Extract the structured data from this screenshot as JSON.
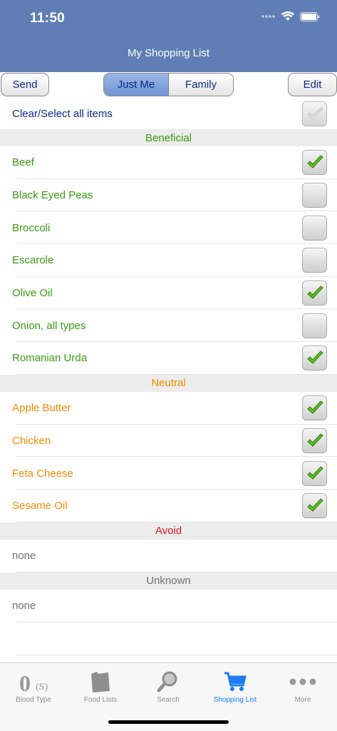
{
  "status": {
    "time": "11:50"
  },
  "nav": {
    "title": "My Shopping List"
  },
  "toolbar": {
    "send_label": "Send",
    "segments": [
      "Just Me",
      "Family"
    ],
    "selected_segment": "Just Me",
    "edit_label": "Edit"
  },
  "clear_all": {
    "label": "Clear/Select all items",
    "checked": true
  },
  "sections": [
    {
      "title": "Beneficial",
      "color": "#3a9a12",
      "items": [
        {
          "label": "Beef",
          "checked": true
        },
        {
          "label": "Black Eyed Peas",
          "checked": false
        },
        {
          "label": "Broccoli",
          "checked": false
        },
        {
          "label": "Escarole",
          "checked": false
        },
        {
          "label": "Olive Oil",
          "checked": true
        },
        {
          "label": "Onion, all types",
          "checked": false
        },
        {
          "label": "Romanian Urda",
          "checked": true
        }
      ]
    },
    {
      "title": "Neutral",
      "color": "#f08c00",
      "items": [
        {
          "label": "Apple Butter",
          "checked": true
        },
        {
          "label": "Chicken",
          "checked": true
        },
        {
          "label": "Feta Cheese",
          "checked": true
        },
        {
          "label": "Sesame Oil",
          "checked": true
        }
      ]
    },
    {
      "title": "Avoid",
      "color": "#e0141b",
      "items": [
        {
          "label": "none",
          "checked": null
        }
      ]
    },
    {
      "title": "Unknown",
      "color": "#707070",
      "items": [
        {
          "label": "none",
          "checked": null
        }
      ]
    }
  ],
  "tabs": [
    {
      "label": "Blood Type",
      "icon": "blood-type-icon",
      "active": false
    },
    {
      "label": "Food Lists",
      "icon": "food-lists-icon",
      "active": false
    },
    {
      "label": "Search",
      "icon": "search-icon",
      "active": false
    },
    {
      "label": "Shopping List",
      "icon": "cart-icon",
      "active": true
    },
    {
      "label": "More",
      "icon": "more-icon",
      "active": false
    }
  ],
  "colors": {
    "header": "#5f7eb5",
    "link_blue": "#0e2a86",
    "none_text": "#707070",
    "tab_active": "#1a7df0"
  }
}
